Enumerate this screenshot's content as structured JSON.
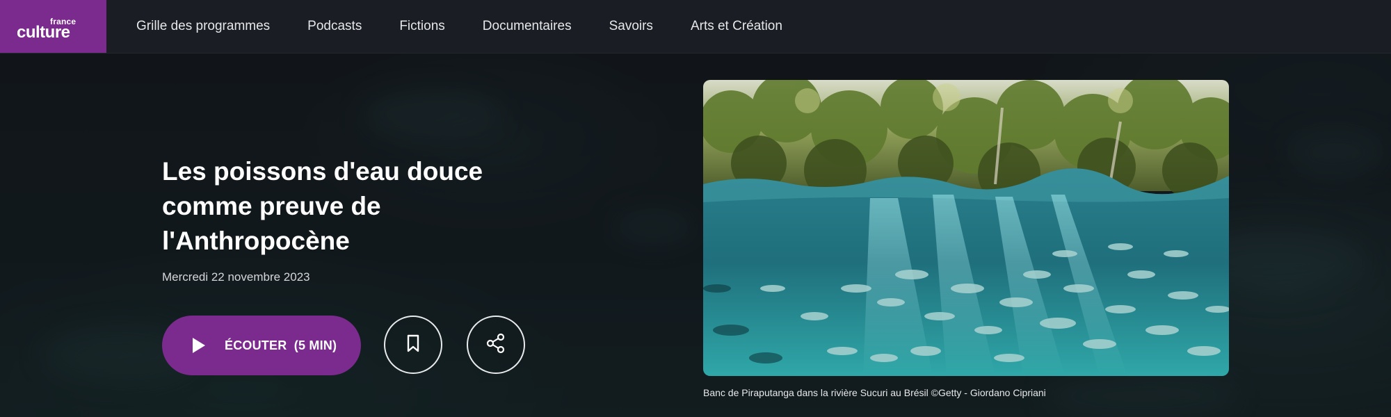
{
  "nav": {
    "logo_small": "france",
    "logo_big": "culture",
    "items": [
      "Grille des programmes",
      "Podcasts",
      "Fictions",
      "Documentaires",
      "Savoirs",
      "Arts et Création"
    ]
  },
  "article": {
    "title": "Les poissons d'eau douce comme preuve de l'Anthropocène",
    "date": "Mercredi 22 novembre 2023",
    "listen_label": "ÉCOUTER  (5 MIN)",
    "image_caption": "Banc de Piraputanga dans la rivière Sucuri au Brésil ©Getty - Giordano Cipriani"
  },
  "icons": {
    "play": "play-icon",
    "bookmark": "bookmark-icon",
    "share": "share-icon"
  },
  "colors": {
    "brand_purple": "#7b2a8e",
    "nav_background": "#1a1e24",
    "page_background": "#151a1e"
  }
}
